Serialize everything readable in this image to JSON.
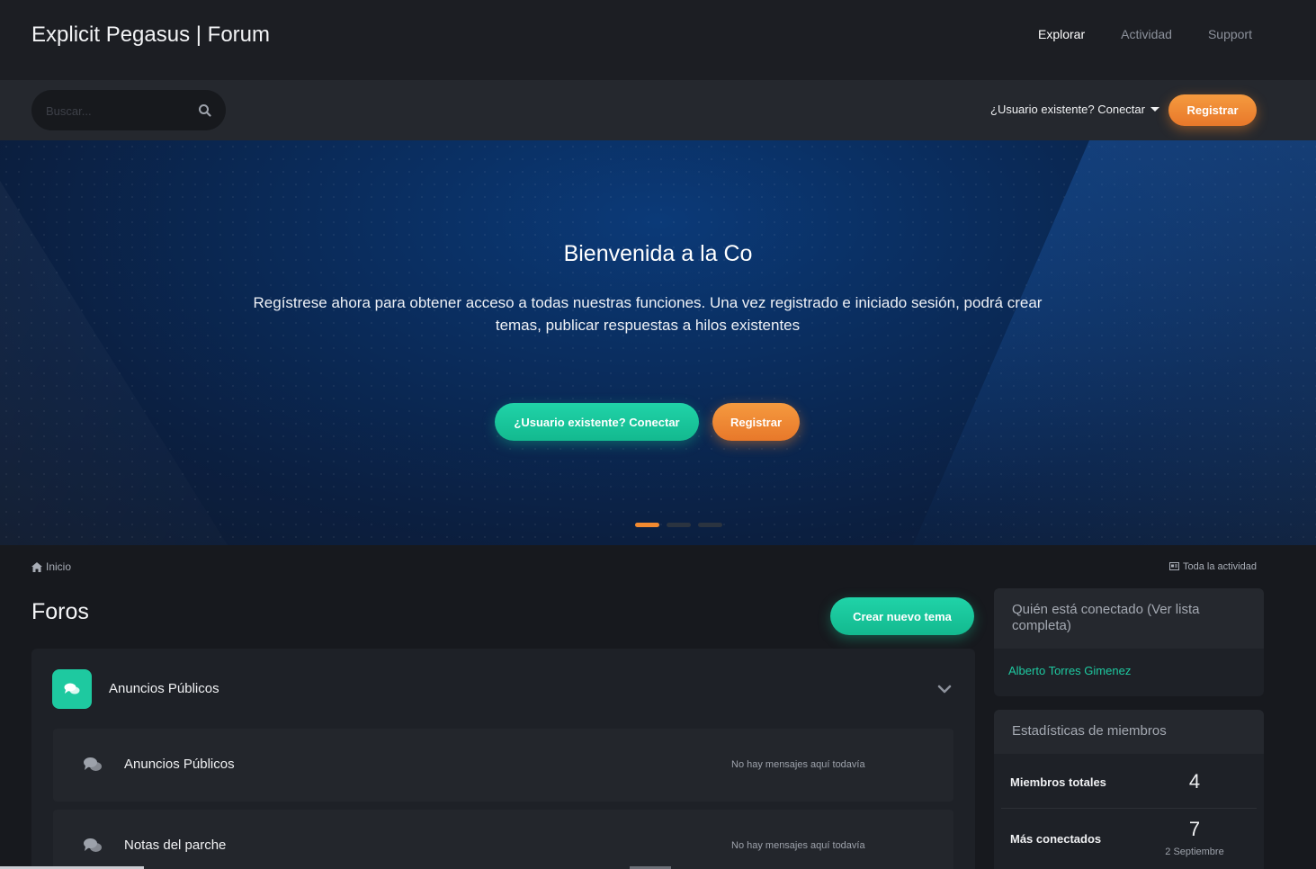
{
  "header": {
    "site_title": "Explicit Pegasus | Forum",
    "nav": [
      {
        "label": "Explorar",
        "active": true
      },
      {
        "label": "Actividad",
        "active": false
      },
      {
        "label": "Support",
        "active": false
      }
    ]
  },
  "subbar": {
    "search_placeholder": "Buscar...",
    "signin_label": "¿Usuario existente? Conectar",
    "register_label": "Registrar"
  },
  "hero": {
    "title": "Bienvenida a la Co",
    "text": "Regístrese ahora para obtener acceso a todas nuestras funciones. Una vez registrado e iniciado sesión, podrá crear temas, publicar respuestas a hilos existentes",
    "login_button": "¿Usuario existente? Conectar",
    "register_button": "Registrar",
    "slides": 3,
    "active_slide": 1
  },
  "breadcrumb": {
    "home_label": "Inicio",
    "all_activity_label": "Toda la actividad"
  },
  "main": {
    "title": "Foros",
    "new_topic_button": "Crear nuevo tema",
    "category": {
      "name": "Anuncios Públicos",
      "forums": [
        {
          "name": "Anuncios Públicos",
          "status": "No hay mensajes aquí todavía"
        },
        {
          "name": "Notas del parche",
          "status": "No hay mensajes aquí todavía"
        }
      ]
    }
  },
  "sidebar": {
    "online": {
      "title": "Quién está conectado (Ver lista completa)",
      "users": [
        "Alberto Torres Gimenez"
      ]
    },
    "stats": {
      "title": "Estadísticas de miembros",
      "rows": [
        {
          "label": "Miembros totales",
          "value": "4",
          "sub": ""
        },
        {
          "label": "Más conectados",
          "value": "7",
          "sub": "2 Septiembre"
        }
      ]
    }
  },
  "colors": {
    "accent_teal": "#1ec9a0",
    "accent_orange": "#f28a30",
    "background": "#17191e"
  },
  "icons": [
    "search-icon",
    "caret-down-icon",
    "home-icon",
    "activity-icon",
    "chat-bubbles-icon",
    "chevron-down-icon"
  ]
}
